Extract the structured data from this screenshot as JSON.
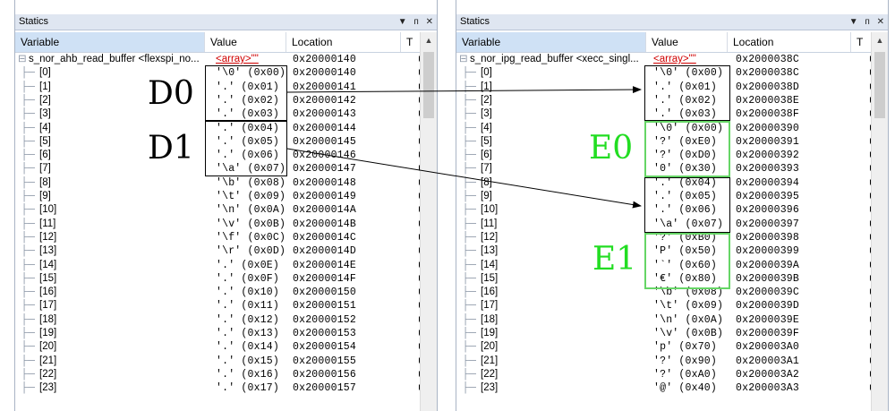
{
  "panels": [
    {
      "title": "Statics",
      "buttons": [
        "▼",
        "ᴨ",
        "✕"
      ],
      "columns": [
        "Variable",
        "Value",
        "Location",
        "T"
      ],
      "root": {
        "variable": "s_nor_ahb_read_buffer <flexspi_no...",
        "value": "<array>\"\"",
        "location": "0x20000140",
        "type": "uir"
      },
      "rows": [
        {
          "idx": "[0]",
          "value": "'\\0' (0x00)",
          "location": "0x20000140",
          "type": "uir"
        },
        {
          "idx": "[1]",
          "value": "'.' (0x01)",
          "location": "0x20000141",
          "type": "uir"
        },
        {
          "idx": "[2]",
          "value": "'.' (0x02)",
          "location": "0x20000142",
          "type": "uir"
        },
        {
          "idx": "[3]",
          "value": "'.' (0x03)",
          "location": "0x20000143",
          "type": "uir"
        },
        {
          "idx": "[4]",
          "value": "'.' (0x04)",
          "location": "0x20000144",
          "type": "uir"
        },
        {
          "idx": "[5]",
          "value": "'.' (0x05)",
          "location": "0x20000145",
          "type": "uir"
        },
        {
          "idx": "[6]",
          "value": "'.' (0x06)",
          "location": "0x20000146",
          "type": "uir"
        },
        {
          "idx": "[7]",
          "value": "'\\a' (0x07)",
          "location": "0x20000147",
          "type": "uir"
        },
        {
          "idx": "[8]",
          "value": "'\\b' (0x08)",
          "location": "0x20000148",
          "type": "uir"
        },
        {
          "idx": "[9]",
          "value": "'\\t' (0x09)",
          "location": "0x20000149",
          "type": "uir"
        },
        {
          "idx": "[10]",
          "value": "'\\n' (0x0A)",
          "location": "0x2000014A",
          "type": "uir"
        },
        {
          "idx": "[11]",
          "value": "'\\v' (0x0B)",
          "location": "0x2000014B",
          "type": "uir"
        },
        {
          "idx": "[12]",
          "value": "'\\f' (0x0C)",
          "location": "0x2000014C",
          "type": "uir"
        },
        {
          "idx": "[13]",
          "value": "'\\r' (0x0D)",
          "location": "0x2000014D",
          "type": "uir"
        },
        {
          "idx": "[14]",
          "value": "'.' (0x0E)",
          "location": "0x2000014E",
          "type": "uir"
        },
        {
          "idx": "[15]",
          "value": "'.' (0x0F)",
          "location": "0x2000014F",
          "type": "uir"
        },
        {
          "idx": "[16]",
          "value": "'.' (0x10)",
          "location": "0x20000150",
          "type": "uir"
        },
        {
          "idx": "[17]",
          "value": "'.' (0x11)",
          "location": "0x20000151",
          "type": "uir"
        },
        {
          "idx": "[18]",
          "value": "'.' (0x12)",
          "location": "0x20000152",
          "type": "uir"
        },
        {
          "idx": "[19]",
          "value": "'.' (0x13)",
          "location": "0x20000153",
          "type": "uir"
        },
        {
          "idx": "[20]",
          "value": "'.' (0x14)",
          "location": "0x20000154",
          "type": "uir"
        },
        {
          "idx": "[21]",
          "value": "'.' (0x15)",
          "location": "0x20000155",
          "type": "uir"
        },
        {
          "idx": "[22]",
          "value": "'.' (0x16)",
          "location": "0x20000156",
          "type": "uir"
        },
        {
          "idx": "[23]",
          "value": "'.' (0x17)",
          "location": "0x20000157",
          "type": "uir"
        }
      ]
    },
    {
      "title": "Statics",
      "buttons": [
        "▼",
        "ᴨ",
        "✕"
      ],
      "columns": [
        "Variable",
        "Value",
        "Location",
        "T"
      ],
      "root": {
        "variable": "s_nor_ipg_read_buffer <xecc_singl...",
        "value": "<array>\"\"",
        "location": "0x2000038C",
        "type": "uir"
      },
      "rows": [
        {
          "idx": "[0]",
          "value": "'\\0' (0x00)",
          "location": "0x2000038C",
          "type": "uir"
        },
        {
          "idx": "[1]",
          "value": "'.' (0x01)",
          "location": "0x2000038D",
          "type": "uir"
        },
        {
          "idx": "[2]",
          "value": "'.' (0x02)",
          "location": "0x2000038E",
          "type": "uir"
        },
        {
          "idx": "[3]",
          "value": "'.' (0x03)",
          "location": "0x2000038F",
          "type": "uir"
        },
        {
          "idx": "[4]",
          "value": "'\\0' (0x00)",
          "location": "0x20000390",
          "type": "uir"
        },
        {
          "idx": "[5]",
          "value": "'?' (0xE0)",
          "location": "0x20000391",
          "type": "uir"
        },
        {
          "idx": "[6]",
          "value": "'?' (0xD0)",
          "location": "0x20000392",
          "type": "uir"
        },
        {
          "idx": "[7]",
          "value": "'0' (0x30)",
          "location": "0x20000393",
          "type": "uir"
        },
        {
          "idx": "[8]",
          "value": "'.' (0x04)",
          "location": "0x20000394",
          "type": "uir"
        },
        {
          "idx": "[9]",
          "value": "'.' (0x05)",
          "location": "0x20000395",
          "type": "uir"
        },
        {
          "idx": "[10]",
          "value": "'.' (0x06)",
          "location": "0x20000396",
          "type": "uir"
        },
        {
          "idx": "[11]",
          "value": "'\\a' (0x07)",
          "location": "0x20000397",
          "type": "uir"
        },
        {
          "idx": "[12]",
          "value": "'?' (0xB0)",
          "location": "0x20000398",
          "type": "uir"
        },
        {
          "idx": "[13]",
          "value": "'P' (0x50)",
          "location": "0x20000399",
          "type": "uir"
        },
        {
          "idx": "[14]",
          "value": "'`' (0x60)",
          "location": "0x2000039A",
          "type": "uir"
        },
        {
          "idx": "[15]",
          "value": "'€' (0x80)",
          "location": "0x2000039B",
          "type": "uir"
        },
        {
          "idx": "[16]",
          "value": "'\\b' (0x08)",
          "location": "0x2000039C",
          "type": "uir"
        },
        {
          "idx": "[17]",
          "value": "'\\t' (0x09)",
          "location": "0x2000039D",
          "type": "uir"
        },
        {
          "idx": "[18]",
          "value": "'\\n' (0x0A)",
          "location": "0x2000039E",
          "type": "uir"
        },
        {
          "idx": "[19]",
          "value": "'\\v' (0x0B)",
          "location": "0x2000039F",
          "type": "uir"
        },
        {
          "idx": "[20]",
          "value": "'p' (0x70)",
          "location": "0x200003A0",
          "type": "uir"
        },
        {
          "idx": "[21]",
          "value": "'?' (0x90)",
          "location": "0x200003A1",
          "type": "uir"
        },
        {
          "idx": "[22]",
          "value": "'?' (0xA0)",
          "location": "0x200003A2",
          "type": "uir"
        },
        {
          "idx": "[23]",
          "value": "'@' (0x40)",
          "location": "0x200003A3",
          "type": "uir"
        }
      ]
    }
  ],
  "annotations": {
    "d0": "D0",
    "d1": "D1",
    "e0": "E0",
    "e1": "E1"
  },
  "colors": {
    "titlebar": "#dfe6f1",
    "selected_header": "#cfe1f5",
    "array_text": "#d00000",
    "green_box": "#66d566",
    "green_label": "#22dd22"
  }
}
